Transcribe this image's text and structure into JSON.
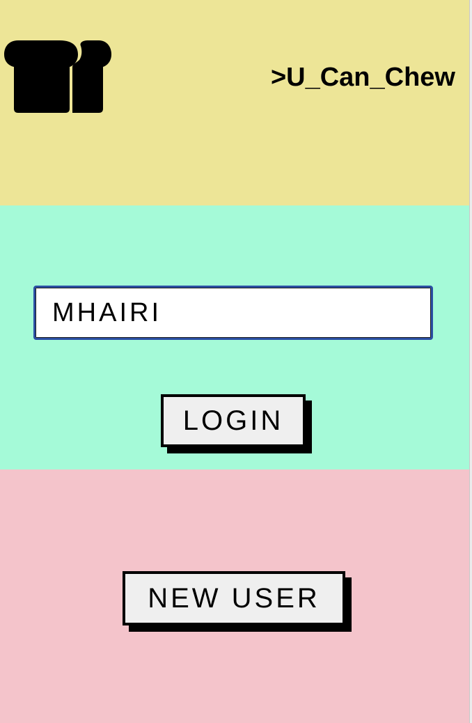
{
  "header": {
    "title": ">U_Can_Chew",
    "logo_icon": "bread-slices-icon",
    "background": "#ede597"
  },
  "login": {
    "username_value": "MHAIRI",
    "login_label": "LOGIN",
    "background": "#a5fad8"
  },
  "signup": {
    "new_user_label": "NEW USER",
    "background": "#f4c4cb"
  }
}
